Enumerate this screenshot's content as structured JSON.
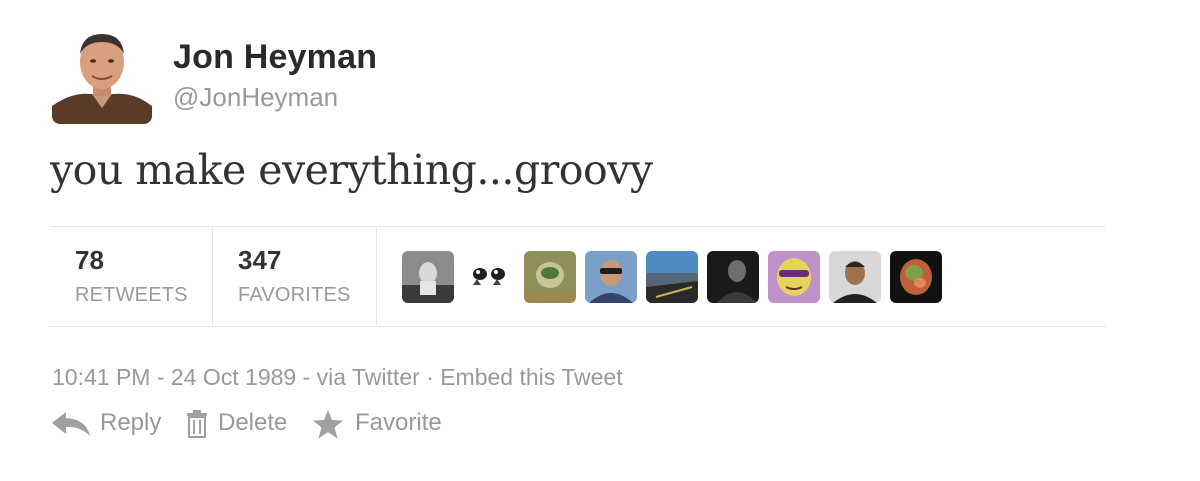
{
  "user": {
    "name": "Jon Heyman",
    "handle": "@JonHeyman"
  },
  "tweet": {
    "text": "you make everything...groovy"
  },
  "stats": {
    "retweets": {
      "count": "78",
      "label": "RETWEETS"
    },
    "favorites": {
      "count": "347",
      "label": "FAVORITES"
    }
  },
  "meta": {
    "timestamp": "10:41 PM - 24 Oct 1989",
    "separator": " - ",
    "via": "via Twitter",
    "dot": " · ",
    "embed": "Embed this Tweet"
  },
  "actions": {
    "reply": {
      "label": "Reply",
      "icon": "reply-arrow-icon"
    },
    "delete": {
      "label": "Delete",
      "icon": "trash-icon"
    },
    "favorite": {
      "label": "Favorite",
      "icon": "star-icon"
    }
  },
  "colors": {
    "muted_text": "#999999",
    "primary_text": "#333333",
    "divider": "#e6e6e6"
  }
}
